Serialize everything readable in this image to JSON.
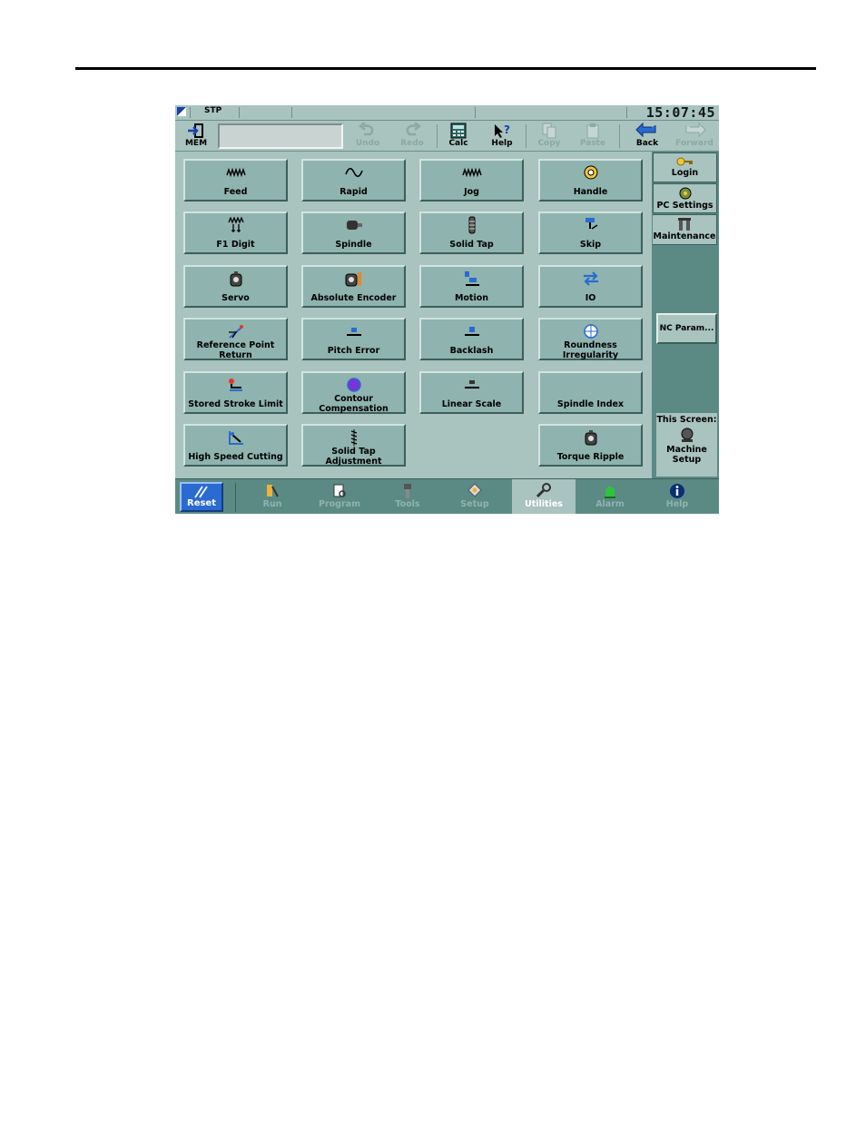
{
  "status": {
    "mode": "STP",
    "clock": "15:07:45"
  },
  "toolbar": {
    "mem": "MEM",
    "undo": "Undo",
    "redo": "Redo",
    "calc": "Calc",
    "help": "Help",
    "copy": "Copy",
    "paste": "Paste",
    "back": "Back",
    "forward": "Forward"
  },
  "grid": [
    [
      "Feed",
      "Rapid",
      "Jog",
      "Handle"
    ],
    [
      "F1 Digit",
      "Spindle",
      "Solid Tap",
      "Skip"
    ],
    [
      "Servo",
      "Absolute Encoder",
      "Motion",
      "IO"
    ],
    [
      "Reference Point Return",
      "Pitch Error",
      "Backlash",
      "Roundness Irregularity"
    ],
    [
      "Stored Stroke Limit",
      "Contour Compensation",
      "Linear Scale",
      "Spindle Index"
    ],
    [
      "High Speed Cutting",
      "Solid Tap Adjustment",
      "",
      "Torque Ripple"
    ]
  ],
  "side": {
    "login": "Login",
    "pc_settings": "PC Settings",
    "maintenance": "Maintenance",
    "nc_param": "NC Param...",
    "this_screen": "This Screen:",
    "machine_setup": "Machine Setup"
  },
  "bottom": {
    "reset": "Reset",
    "run": "Run",
    "program": "Program",
    "tools": "Tools",
    "setup": "Setup",
    "utilities": "Utilities",
    "alarm": "Alarm",
    "help": "Help"
  }
}
